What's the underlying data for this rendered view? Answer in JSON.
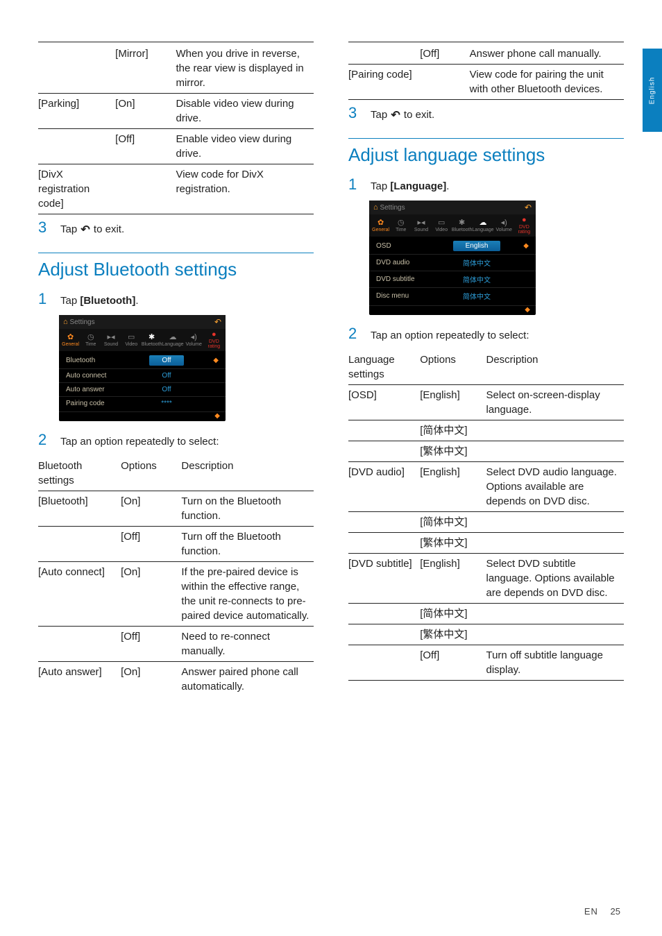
{
  "sideTab": "English",
  "left": {
    "table1": {
      "rows": [
        {
          "c1": "",
          "c2": "[Mirror]",
          "c3": "When you drive in reverse, the rear view is displayed in mirror."
        },
        {
          "c1": "[Parking]",
          "c2": "[On]",
          "c3": "Disable video view during drive."
        },
        {
          "c1": "",
          "c2": "[Off]",
          "c3": "Enable video view during drive."
        },
        {
          "c1": "[DivX registration code]",
          "c2": "",
          "c3": "View code for DivX registration."
        }
      ]
    },
    "step3": {
      "num": "3",
      "pre": "Tap ",
      "post": " to exit."
    },
    "sectionBT": "Adjust Bluetooth settings",
    "stepBT1": {
      "num": "1",
      "pre": "Tap ",
      "bold": "[Bluetooth]",
      "post": "."
    },
    "shotBT": {
      "title": "Settings",
      "icons": [
        {
          "g": "✿",
          "t": "General",
          "cls": "gear"
        },
        {
          "g": "◷",
          "t": "Time"
        },
        {
          "g": "▸◂",
          "t": "Sound"
        },
        {
          "g": "▭",
          "t": "Video"
        },
        {
          "g": "✱",
          "t": "Bluetooth",
          "cls": "sel"
        },
        {
          "g": "☁",
          "t": "Language"
        },
        {
          "g": "◂)",
          "t": "Volume"
        },
        {
          "g": "●",
          "t": "DVD rating",
          "cls": "red"
        }
      ],
      "rows": [
        {
          "lbl": "Bluetooth",
          "val": "Off",
          "sel": true
        },
        {
          "lbl": "Auto connect",
          "val": "Off"
        },
        {
          "lbl": "Auto answer",
          "val": "Off"
        },
        {
          "lbl": "Pairing code",
          "val": "****"
        }
      ]
    },
    "stepBT2": {
      "num": "2",
      "text": "Tap an option repeatedly to select:"
    },
    "tableBT": {
      "head": {
        "c1": "Bluetooth settings",
        "c2": "Options",
        "c3": "Description"
      },
      "rows": [
        {
          "c1": "[Bluetooth]",
          "c2": "[On]",
          "c3": "Turn on the Bluetooth function."
        },
        {
          "c1": "",
          "c2": "[Off]",
          "c3": "Turn off the Bluetooth function."
        },
        {
          "c1": "[Auto connect]",
          "c2": "[On]",
          "c3": "If the pre-paired device is within the effective range, the unit re-connects to pre-paired device automatically."
        },
        {
          "c1": "",
          "c2": "[Off]",
          "c3": "Need to re-connect manually."
        },
        {
          "c1": "[Auto answer]",
          "c2": "[On]",
          "c3": "Answer paired phone call automatically."
        }
      ]
    }
  },
  "right": {
    "tableTop": {
      "rows": [
        {
          "c1": "",
          "c2": "[Off]",
          "c3": "Answer phone call manually."
        },
        {
          "c1": "[Pairing code]",
          "c2": "",
          "c3": "View code for pairing the unit with other Bluetooth devices."
        }
      ]
    },
    "step3": {
      "num": "3",
      "pre": "Tap ",
      "post": " to exit."
    },
    "sectionLang": "Adjust language settings",
    "stepL1": {
      "num": "1",
      "pre": "Tap ",
      "bold": "[Language]",
      "post": "."
    },
    "shotLang": {
      "title": "Settings",
      "icons": [
        {
          "g": "✿",
          "t": "General",
          "cls": "gear"
        },
        {
          "g": "◷",
          "t": "Time"
        },
        {
          "g": "▸◂",
          "t": "Sound"
        },
        {
          "g": "▭",
          "t": "Video"
        },
        {
          "g": "✱",
          "t": "Bluetooth"
        },
        {
          "g": "☁",
          "t": "Language",
          "cls": "sel"
        },
        {
          "g": "◂)",
          "t": "Volume"
        },
        {
          "g": "●",
          "t": "DVD rating",
          "cls": "red"
        }
      ],
      "rows": [
        {
          "lbl": "OSD",
          "val": "English",
          "sel": true
        },
        {
          "lbl": "DVD audio",
          "val": "简体中文"
        },
        {
          "lbl": "DVD subtitle",
          "val": "简体中文"
        },
        {
          "lbl": "Disc menu",
          "val": "简体中文"
        }
      ]
    },
    "stepL2": {
      "num": "2",
      "text": "Tap an option repeatedly to select:"
    },
    "tableLang": {
      "head": {
        "c1": "Language settings",
        "c2": "Options",
        "c3": "Description"
      },
      "rows": [
        {
          "c1": "[OSD]",
          "c2": "[English]",
          "c3": "Select on-screen-display language."
        },
        {
          "c1": "",
          "c2": "[简体中文]",
          "c3": ""
        },
        {
          "c1": "",
          "c2": "[繁体中文]",
          "c3": ""
        },
        {
          "c1": "[DVD audio]",
          "c2": "[English]",
          "c3": "Select DVD audio language. Options available are depends on DVD disc."
        },
        {
          "c1": "",
          "c2": "[简体中文]",
          "c3": ""
        },
        {
          "c1": "",
          "c2": "[繁体中文]",
          "c3": ""
        },
        {
          "c1": "[DVD subtitle]",
          "c2": "[English]",
          "c3": "Select DVD subtitle language. Options available are depends on DVD disc."
        },
        {
          "c1": "",
          "c2": "[简体中文]",
          "c3": ""
        },
        {
          "c1": "",
          "c2": "[繁体中文]",
          "c3": ""
        },
        {
          "c1": "",
          "c2": "[Off]",
          "c3": "Turn off subtitle language display."
        }
      ]
    }
  },
  "footer": {
    "en": "EN",
    "page": "25"
  }
}
